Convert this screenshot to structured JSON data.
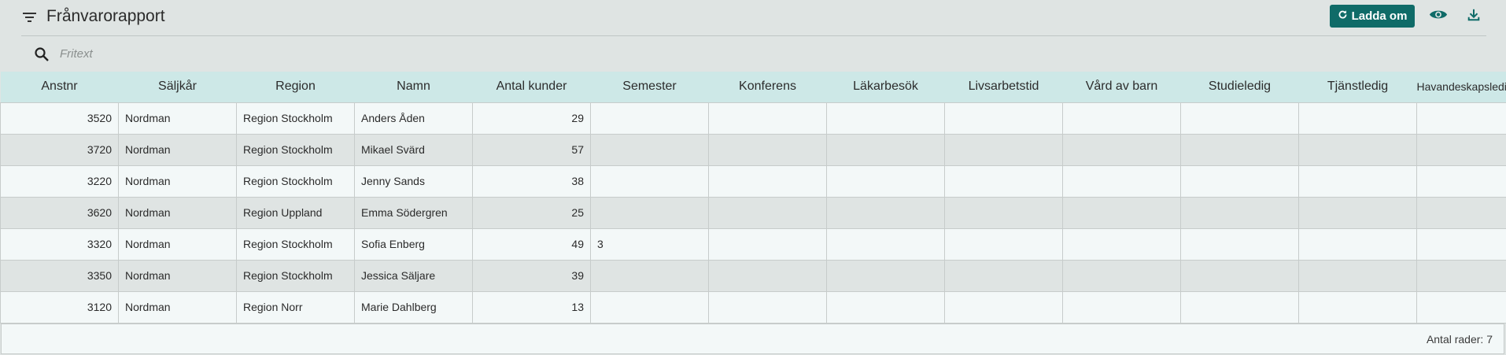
{
  "header": {
    "title": "Frånvarorapport",
    "reload_label": "Ladda om"
  },
  "search": {
    "placeholder": "Fritext",
    "value": ""
  },
  "columns": [
    "Anstnr",
    "Säljkår",
    "Region",
    "Namn",
    "Antal kunder",
    "Semester",
    "Konferens",
    "Läkarbesök",
    "Livsarbetstid",
    "Vård av barn",
    "Studieledig",
    "Tjänstledig",
    "Havandeskapsledig"
  ],
  "rows": [
    [
      "3520",
      "Nordman",
      "Region Stockholm",
      "Anders Åden",
      "29",
      "",
      "",
      "",
      "",
      "",
      "",
      "",
      ""
    ],
    [
      "3720",
      "Nordman",
      "Region Stockholm",
      "Mikael Svärd",
      "57",
      "",
      "",
      "",
      "",
      "",
      "",
      "",
      ""
    ],
    [
      "3220",
      "Nordman",
      "Region Stockholm",
      "Jenny Sands",
      "38",
      "",
      "",
      "",
      "",
      "",
      "",
      "",
      ""
    ],
    [
      "3620",
      "Nordman",
      "Region Uppland",
      "Emma Södergren",
      "25",
      "",
      "",
      "",
      "",
      "",
      "",
      "",
      ""
    ],
    [
      "3320",
      "Nordman",
      "Region Stockholm",
      "Sofia Enberg",
      "49",
      "3",
      "",
      "",
      "",
      "",
      "",
      "",
      ""
    ],
    [
      "3350",
      "Nordman",
      "Region Stockholm",
      "Jessica Säljare",
      "39",
      "",
      "",
      "",
      "",
      "",
      "",
      "",
      ""
    ],
    [
      "3120",
      "Nordman",
      "Region Norr",
      "Marie Dahlberg",
      "13",
      "",
      "",
      "",
      "",
      "",
      "",
      "",
      ""
    ]
  ],
  "footer": {
    "row_count": "Antal rader: 7"
  },
  "colors": {
    "accent": "#0f6b68",
    "header_bg": "#cde8e7",
    "row_light": "#f3f8f8",
    "row_dark": "#dfe4e3"
  },
  "icons": [
    "filter-icon",
    "refresh-icon",
    "eye-icon",
    "download-icon",
    "search-icon"
  ]
}
